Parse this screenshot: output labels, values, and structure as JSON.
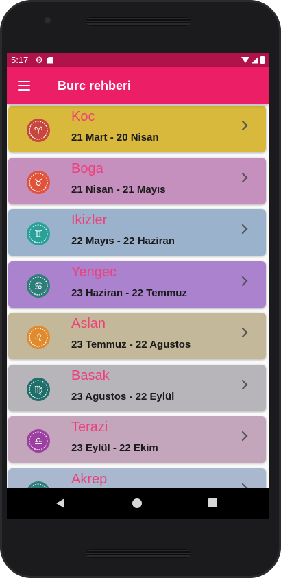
{
  "status_bar": {
    "time": "5:17",
    "icons": [
      "gear-icon",
      "sd-card-icon",
      "wifi-icon",
      "signal-icon",
      "battery-icon"
    ],
    "color": "#b0124a"
  },
  "app_bar": {
    "title": "Burc rehberi",
    "menu_icon": "hamburger-menu-icon",
    "color": "#ec1e66"
  },
  "signs": [
    {
      "name": "Koc",
      "dates": "21 Mart - 20 Nisan",
      "bg": "#d9b93c",
      "icon": "aries-icon",
      "icon_color": "#c8473c",
      "icon_glyph": "♈"
    },
    {
      "name": "Boga",
      "dates": "21 Nisan - 21 Mayıs",
      "bg": "#c58fbe",
      "icon": "taurus-icon",
      "icon_color": "#e0533a",
      "icon_glyph": "♉"
    },
    {
      "name": "Ikizler",
      "dates": "22 Mayıs - 22 Haziran",
      "bg": "#9bb2cc",
      "icon": "gemini-icon",
      "icon_color": "#2aa198",
      "icon_glyph": "♊"
    },
    {
      "name": "Yengec",
      "dates": "23 Haziran - 22 Temmuz",
      "bg": "#ab82ce",
      "icon": "cancer-icon",
      "icon_color": "#2e7d7a",
      "icon_glyph": "♋"
    },
    {
      "name": "Aslan",
      "dates": "23 Temmuz - 22 Agustos",
      "bg": "#c4b89a",
      "icon": "leo-icon",
      "icon_color": "#e08a2e",
      "icon_glyph": "♌"
    },
    {
      "name": "Basak",
      "dates": "23 Agustos - 22 Eylül",
      "bg": "#b7b4ba",
      "icon": "virgo-icon",
      "icon_color": "#1f6e6a",
      "icon_glyph": "♍"
    },
    {
      "name": "Terazi",
      "dates": "23 Eylül - 22 Ekim",
      "bg": "#c3a6bc",
      "icon": "libra-icon",
      "icon_color": "#9b3fa0",
      "icon_glyph": "♎"
    },
    {
      "name": "Akrep",
      "dates": "",
      "bg": "#a9b8cf",
      "icon": "scorpio-icon",
      "icon_color": "#2e7d7a",
      "icon_glyph": "♏"
    }
  ],
  "nav": {
    "back": "back-icon",
    "home": "home-icon",
    "recents": "recents-icon"
  }
}
